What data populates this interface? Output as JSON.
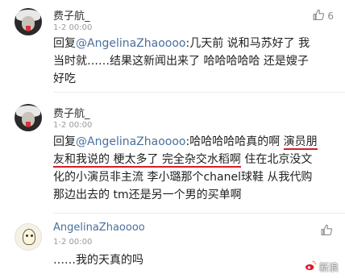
{
  "comments": [
    {
      "user": "费子航_",
      "time": "1-2 00:00",
      "likes": "6",
      "lines": [
        {
          "prefix": "回复",
          "mention": "@AngelinaZhaoooo",
          "rest": ":几天前 说和马苏好了 我"
        },
        {
          "text": "当时就……结果这新闻出来了 哈哈哈哈哈 还是嫂子"
        },
        {
          "text": "好吃"
        }
      ]
    },
    {
      "user": "费子航_",
      "time": "1-2 00:00",
      "likes": "",
      "lines": [
        {
          "prefix": "回复",
          "mention": "@AngelinaZhaoooo",
          "rest": ":哈哈哈哈哈真的啊 ",
          "hl": "演员朋"
        },
        {
          "hl": "友和我说的 梗太多了 完全杂交水稻啊",
          "rest": " 住在北京没文"
        },
        {
          "text": "化的小演员非主流 李小璐那个chanel球鞋 从我代购"
        },
        {
          "text": "那边出去的 tm还是另一个男的买单啊"
        }
      ]
    },
    {
      "user": "AngelinaZhaoooo",
      "time": "1-2 00:00",
      "likes": "",
      "lines": [
        {
          "text": "……我的天真的吗"
        }
      ]
    }
  ],
  "watermark": {
    "label": "新浪"
  },
  "icons": {
    "like": "thumbs-up-icon",
    "watermark": "weibo-logo-icon"
  },
  "colors": {
    "mention": "#4a6f9c",
    "underline": "#d0202a",
    "meta": "#9a9a9a"
  }
}
